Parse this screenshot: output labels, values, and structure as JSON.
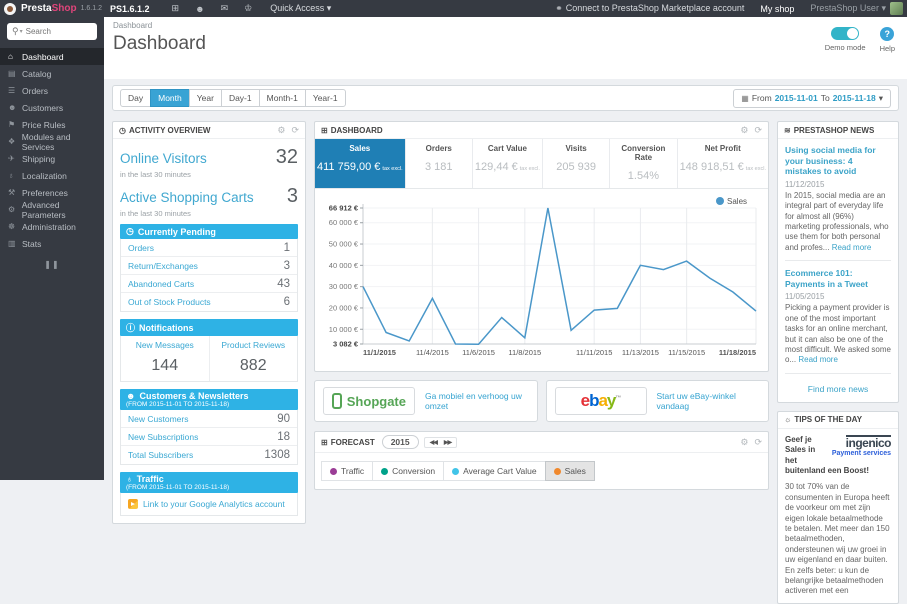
{
  "icons": {
    "cart": "⊞",
    "user": "☻",
    "mail": "✉",
    "trophy": "♔",
    "link": "⚭",
    "caret": "▾",
    "search": "⚲",
    "gear": "⚙",
    "refresh": "⟳",
    "clock": "◷",
    "info": "ⓘ",
    "globe": "♁",
    "rss": "≋",
    "bulb": "☼",
    "calendar": "▦",
    "rewind": "◀◀",
    "forward": "▶▶",
    "pause": "❚❚",
    "question": "?"
  },
  "topbar": {
    "brand_presta": "Presta",
    "brand_shop": "Shop",
    "version": "1.6.1.2",
    "shop_name": "PS1.6.1.2",
    "quick_access": "Quick Access",
    "marketplace_link": "Connect to PrestaShop Marketplace account",
    "my_shop": "My shop",
    "user": "PrestaShop User"
  },
  "sidebar": {
    "search_placeholder": "Search",
    "items": [
      {
        "label": "Dashboard",
        "icon": "⌂"
      },
      {
        "label": "Catalog",
        "icon": "▤"
      },
      {
        "label": "Orders",
        "icon": "☰"
      },
      {
        "label": "Customers",
        "icon": "☻"
      },
      {
        "label": "Price Rules",
        "icon": "⚑"
      },
      {
        "label": "Modules and Services",
        "icon": "❖"
      },
      {
        "label": "Shipping",
        "icon": "✈"
      },
      {
        "label": "Localization",
        "icon": "♁"
      },
      {
        "label": "Preferences",
        "icon": "⚒"
      },
      {
        "label": "Advanced Parameters",
        "icon": "⚙"
      },
      {
        "label": "Administration",
        "icon": "☸"
      },
      {
        "label": "Stats",
        "icon": "▥"
      }
    ]
  },
  "header": {
    "breadcrumb": "Dashboard",
    "title": "Dashboard",
    "demo_mode": "Demo mode",
    "help": "Help"
  },
  "filters": {
    "ranges": [
      "Day",
      "Month",
      "Year",
      "Day-1",
      "Month-1",
      "Year-1"
    ],
    "active": "Month",
    "from_label": "From",
    "date_from": "2015-11-01",
    "to_label": "To",
    "date_to": "2015-11-18"
  },
  "activity": {
    "title": "ACTIVITY OVERVIEW",
    "online_visitors": {
      "label": "Online Visitors",
      "value": "32",
      "sub": "in the last 30 minutes"
    },
    "active_carts": {
      "label": "Active Shopping Carts",
      "value": "3",
      "sub": "in the last 30 minutes"
    },
    "pending": {
      "title": "Currently Pending",
      "rows": [
        {
          "label": "Orders",
          "value": "1"
        },
        {
          "label": "Return/Exchanges",
          "value": "3"
        },
        {
          "label": "Abandoned Carts",
          "value": "43"
        },
        {
          "label": "Out of Stock Products",
          "value": "6"
        }
      ]
    },
    "notifications": {
      "title": "Notifications",
      "cols": [
        {
          "label": "New Messages",
          "value": "144"
        },
        {
          "label": "Product Reviews",
          "value": "882"
        }
      ]
    },
    "customers": {
      "title": "Customers & Newsletters",
      "subtitle": "(FROM 2015-11-01 TO 2015-11-18)",
      "rows": [
        {
          "label": "New Customers",
          "value": "90"
        },
        {
          "label": "New Subscriptions",
          "value": "18"
        },
        {
          "label": "Total Subscribers",
          "value": "1308"
        }
      ]
    },
    "traffic": {
      "title": "Traffic",
      "subtitle": "(FROM 2015-11-01 TO 2015-11-18)",
      "link": "Link to your Google Analytics account"
    }
  },
  "dashboard_panel": {
    "title": "DASHBOARD",
    "kpis": [
      {
        "label": "Sales",
        "value": "411 759,00 €",
        "suffix": "tax excl."
      },
      {
        "label": "Orders",
        "value": "3 181"
      },
      {
        "label": "Cart Value",
        "value": "129,44 €",
        "suffix": "tax excl."
      },
      {
        "label": "Visits",
        "value": "205 939"
      },
      {
        "label": "Conversion Rate",
        "value": "1.54%"
      },
      {
        "label": "Net Profit",
        "value": "148 918,51 €",
        "suffix": "tax excl."
      }
    ]
  },
  "chart_data": {
    "type": "line",
    "legend": "Sales",
    "line_color": "#4a97c9",
    "x": [
      "11/1/2015",
      "11/2/2015",
      "11/3/2015",
      "11/4/2015",
      "11/5/2015",
      "11/6/2015",
      "11/7/2015",
      "11/8/2015",
      "11/9/2015",
      "11/10/2015",
      "11/11/2015",
      "11/12/2015",
      "11/13/2015",
      "11/14/2015",
      "11/15/2015",
      "11/16/2015",
      "11/17/2015",
      "11/18/2015"
    ],
    "values": [
      30000,
      8500,
      4500,
      24500,
      3082,
      3000,
      15500,
      6000,
      66912,
      9500,
      19000,
      19800,
      40000,
      38000,
      42000,
      34000,
      27500,
      18500
    ],
    "ymin": 3082,
    "ymax": 66912,
    "y_ticks": [
      {
        "label": "66 912 €",
        "value": 66912,
        "bold": true
      },
      {
        "label": "60 000 €",
        "value": 60000
      },
      {
        "label": "50 000 €",
        "value": 50000
      },
      {
        "label": "40 000 €",
        "value": 40000
      },
      {
        "label": "30 000 €",
        "value": 30000
      },
      {
        "label": "20 000 €",
        "value": 20000
      },
      {
        "label": "10 000 €",
        "value": 10000
      },
      {
        "label": "3 082 €",
        "value": 3082,
        "bold": true
      }
    ],
    "x_tick_indices": [
      0,
      3,
      5,
      7,
      10,
      12,
      14,
      17
    ],
    "grid": true,
    "legend_position": "top-right"
  },
  "modules": [
    {
      "name": "Shopgate",
      "link": "Ga mobiel en verhoog uw omzet"
    },
    {
      "name": "ebay",
      "tm": "™",
      "link": "Start uw eBay-winkel vandaag",
      "letters": [
        {
          "ch": "e",
          "color": "#e53238"
        },
        {
          "ch": "b",
          "color": "#0064d2"
        },
        {
          "ch": "a",
          "color": "#f5af02"
        },
        {
          "ch": "y",
          "color": "#86b817"
        }
      ]
    }
  ],
  "forecast": {
    "title": "FORECAST",
    "year": "2015",
    "tabs": [
      {
        "label": "Traffic",
        "color": "#9b3d96"
      },
      {
        "label": "Conversion",
        "color": "#00a28a"
      },
      {
        "label": "Average Cart Value",
        "color": "#41c4e8"
      },
      {
        "label": "Sales",
        "color": "#f0882c",
        "active": true
      }
    ]
  },
  "news": {
    "title": "PRESTASHOP NEWS",
    "articles": [
      {
        "title": "Using social media for your business: 4 mistakes to avoid",
        "date": "11/12/2015",
        "excerpt": "In 2015, social media are an integral part of everyday life for almost all (96%) marketing professionals, who use them for both personal and profes... ",
        "read_more": "Read more"
      },
      {
        "title": "Ecommerce 101: Payments in a Tweet",
        "date": "11/05/2015",
        "excerpt": "Picking a payment provider is one of the most important tasks for an online merchant, but it can also be one of the most difficult. We asked some o... ",
        "read_more": "Read more"
      }
    ],
    "footer_link": "Find more news"
  },
  "tips": {
    "title": "TIPS OF THE DAY",
    "headline": "Geef je Sales in het buitenland een Boost!",
    "logo_main": "ingenico",
    "logo_sub": "Payment services",
    "body": "30 tot 70% van de consumenten in Europa heeft de voorkeur om met zijn eigen lokale betaalmethode te betalen. Met meer dan 150 betaalmethoden, ondersteunen wij uw groei in uw eigenland en daar buiten. En zelfs beter: u kun de belangrijke betaalmethoden activeren met een"
  }
}
